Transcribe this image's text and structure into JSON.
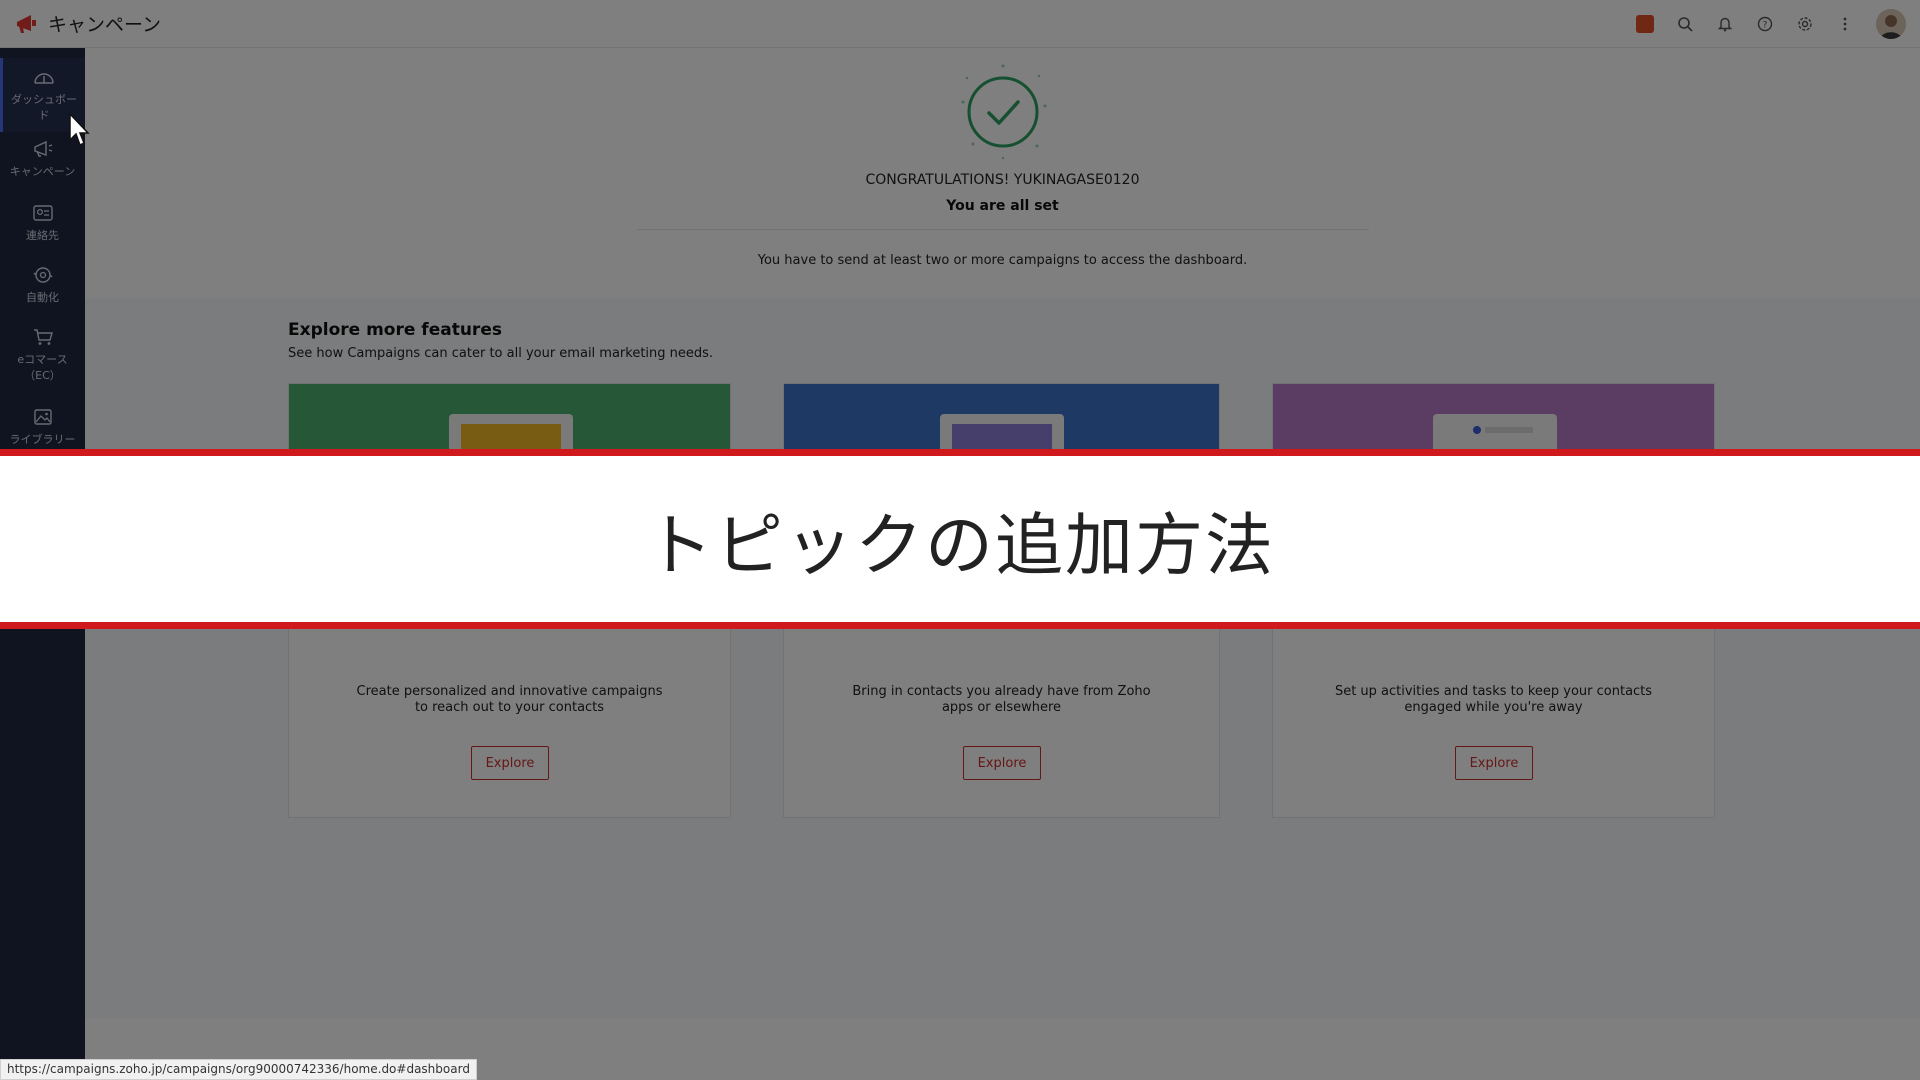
{
  "header": {
    "title": "キャンペーン",
    "icons": [
      "upgrade-icon",
      "search-icon",
      "bell-icon",
      "help-icon",
      "gear-icon",
      "more-icon",
      "avatar"
    ]
  },
  "sidebar": {
    "items": [
      {
        "label": "ダッシュボード",
        "icon": "dashboard-icon"
      },
      {
        "label": "キャンペーン",
        "icon": "megaphone-icon"
      },
      {
        "label": "連絡先",
        "icon": "contacts-icon"
      },
      {
        "label": "自動化",
        "icon": "automation-icon"
      },
      {
        "label": "eコマース（EC）",
        "icon": "cart-icon"
      },
      {
        "label": "ライブラリー",
        "icon": "library-icon"
      }
    ]
  },
  "main": {
    "congrats": "CONGRATULATIONS! YUKINAGASE0120",
    "allset": "You are all set",
    "access_msg": "You have to send at least two or more campaigns to access the dashboard.",
    "explore": {
      "title": "Explore more features",
      "subtitle": "See how Campaigns can cater to all your email marketing needs.",
      "cards": [
        {
          "desc": "Create personalized and innovative campaigns to reach out to your contacts",
          "button": "Explore",
          "color": "#4caf6e"
        },
        {
          "desc": "Bring in contacts you already have from Zoho apps or elsewhere",
          "button": "Explore",
          "color": "#3d73c7"
        },
        {
          "desc": "Set up activities and tasks to keep your contacts engaged while you're away",
          "button": "Explore",
          "color": "#b77ac9"
        }
      ]
    }
  },
  "banner": {
    "text": "トピックの追加方法"
  },
  "status_url": "https://campaigns.zoho.jp/campaigns/org90000742336/home.do#dashboard",
  "colors": {
    "sidebar_bg": "#1e2940",
    "accent_red": "#d0191d",
    "button_red": "#c9302c",
    "success_green": "#2e9e62"
  }
}
